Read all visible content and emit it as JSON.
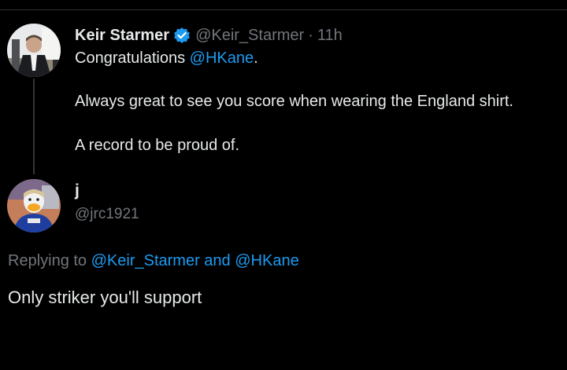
{
  "original_tweet": {
    "display_name": "Keir Starmer",
    "handle": "@Keir_Starmer",
    "separator": "·",
    "time": "11h",
    "line1_prefix": "Congratulations ",
    "line1_mention": "@HKane",
    "line1_suffix": ".",
    "line2": "Always great to see you score when wearing the England shirt.",
    "line3": "A record to be proud of.",
    "verified_icon": "verified-badge-icon"
  },
  "reply": {
    "display_name": "j",
    "handle": "@jrc1921",
    "replying_label": "Replying to ",
    "replying_mention1": "@Keir_Starmer",
    "replying_and": " and ",
    "replying_mention2": "@HKane",
    "text": "Only striker you'll support"
  },
  "colors": {
    "background": "#000000",
    "text_primary": "#e7e9ea",
    "text_secondary": "#71767b",
    "link": "#1d9bf0",
    "verified": "#1d9bf0"
  }
}
